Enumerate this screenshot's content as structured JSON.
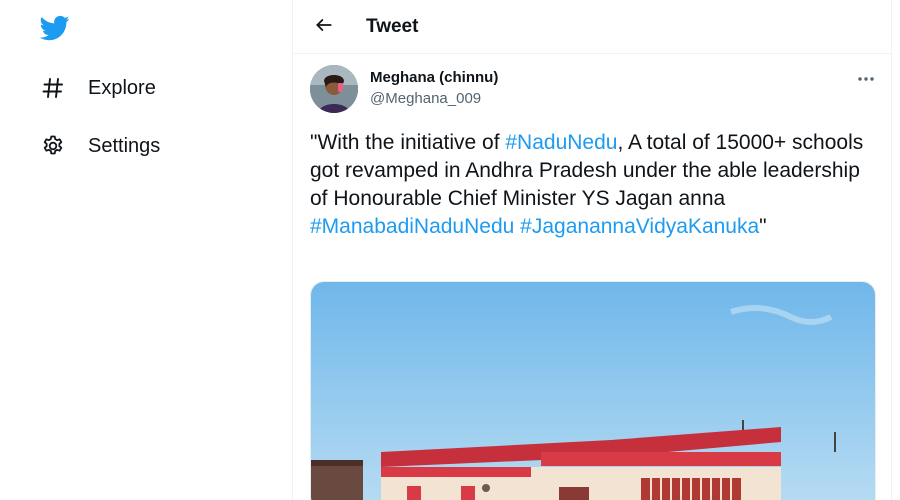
{
  "sidebar": {
    "logo": "twitter-bird-icon",
    "items": [
      {
        "label": "Explore",
        "icon": "hashtag-icon"
      },
      {
        "label": "Settings",
        "icon": "gear-icon"
      }
    ]
  },
  "header": {
    "back_icon": "back-arrow-icon",
    "title": "Tweet"
  },
  "tweet": {
    "author_name": "Meghana (chinnu)",
    "author_handle": "@Meghana_009",
    "more_icon": "more-icon",
    "text": {
      "part1": "\"With the initiative of ",
      "tag1": "#NaduNedu",
      "part2": ", A total of 15000+ schools got revamped in Andhra Pradesh under the able leadership of Honourable Chief Minister YS Jagan anna",
      "tag2": "#ManabadiNaduNedu",
      "tag3": "#JaganannaVidyaKanuka",
      "part3": "\""
    }
  },
  "colors": {
    "accent": "#1d9bf0",
    "text": "#0f1419",
    "secondary": "#536471",
    "border": "#eff3f4"
  }
}
